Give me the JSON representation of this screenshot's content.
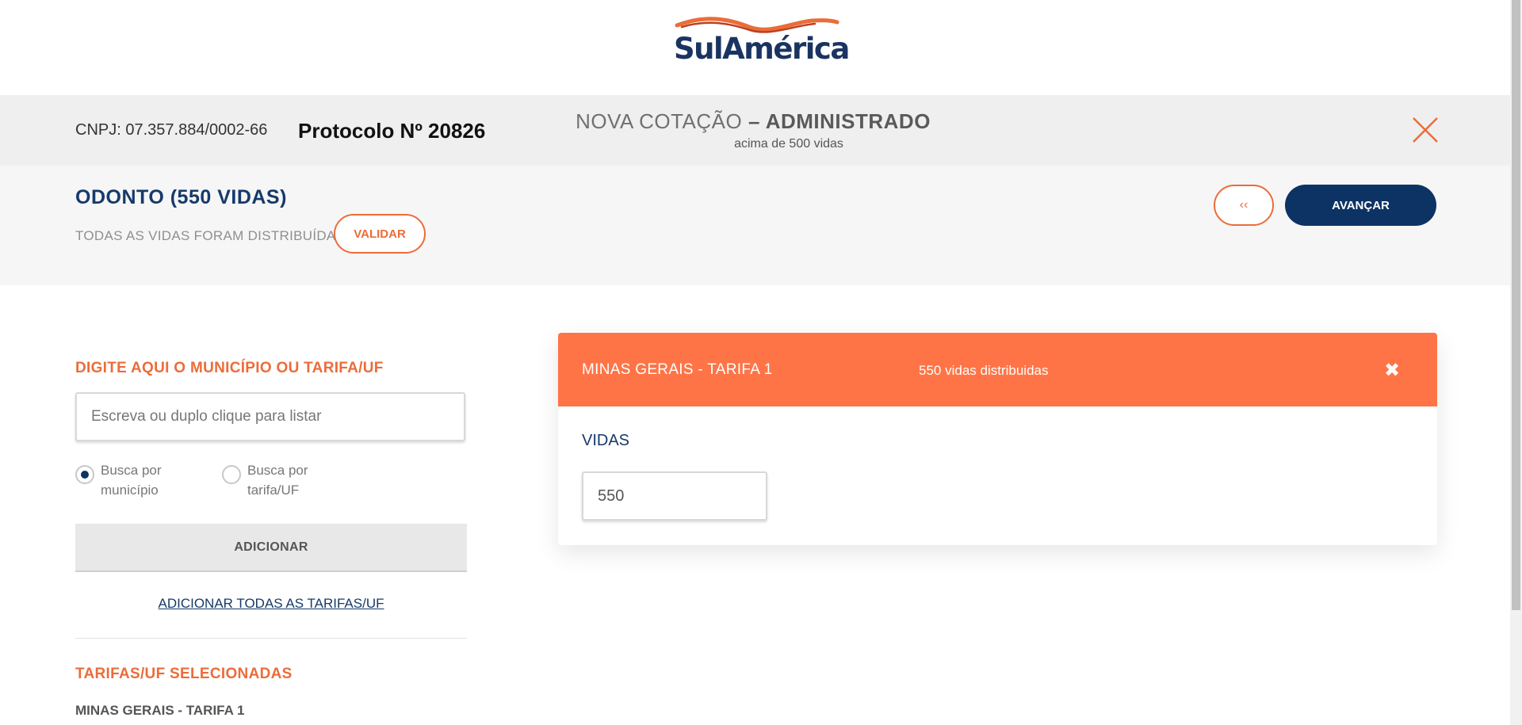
{
  "header": {
    "logo_text": "SulAmérica",
    "brand_colors": {
      "navy": "#1a3462",
      "orange": "#ec6c39"
    }
  },
  "topbar": {
    "cnpj": "CNPJ: 07.357.884/0002-66",
    "protocolo": "Protocolo Nº 20826",
    "title_light": "NOVA COTAÇÃO",
    "title_bold": "– ADMINISTRADO",
    "subtitle": "acima de 500 vidas",
    "close_icon": "close-x-icon"
  },
  "section": {
    "heading": "ODONTO (550 VIDAS)",
    "status": "TODAS AS VIDAS FORAM DISTRIBUÍDAS",
    "validar_label": "VALIDAR",
    "back_label": "‹‹",
    "avancar_label": "AVANÇAR"
  },
  "search": {
    "label": "DIGITE AQUI O MUNICÍPIO OU TARIFA/UF",
    "placeholder": "Escreva ou duplo clique para listar",
    "value": "",
    "radio_options": [
      {
        "label": "Busca por município",
        "checked": true
      },
      {
        "label": "Busca por tarifa/UF",
        "checked": false
      }
    ],
    "adicionar_label": "ADICIONAR",
    "adicionar_todas_label": "ADICIONAR TODAS AS TARIFAS/UF"
  },
  "selected": {
    "label": "TARIFAS/UF SELECIONADAS",
    "items": [
      "MINAS GERAIS - TARIFA 1"
    ]
  },
  "card": {
    "title": "MINAS GERAIS - TARIFA 1",
    "distributed": "550 vidas distribuidas",
    "close_icon": "close-icon",
    "vidas_label": "VIDAS",
    "vidas_value": "550",
    "header_color": "#ff7446"
  }
}
